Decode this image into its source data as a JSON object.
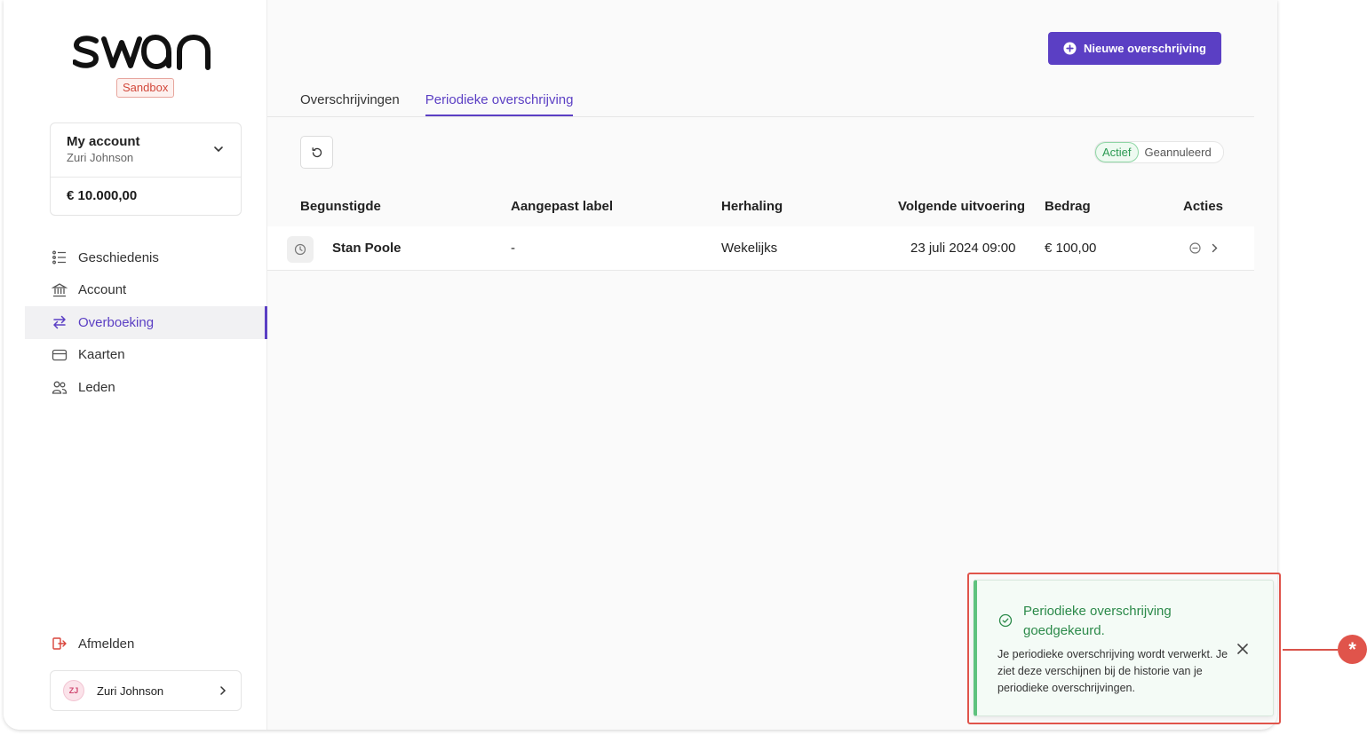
{
  "brand": {
    "logo_text": "swan",
    "env_badge": "Sandbox",
    "accent": "#5b3fc4"
  },
  "account": {
    "name": "My account",
    "holder": "Zuri Johnson",
    "balance": "€ 10.000,00"
  },
  "nav": {
    "items": [
      {
        "label": "Geschiedenis",
        "icon": "list-icon"
      },
      {
        "label": "Account",
        "icon": "bank-icon"
      },
      {
        "label": "Overboeking",
        "icon": "transfer-arrows-icon",
        "active": true
      },
      {
        "label": "Kaarten",
        "icon": "card-icon"
      },
      {
        "label": "Leden",
        "icon": "members-icon"
      }
    ],
    "logout": "Afmelden"
  },
  "user": {
    "initials": "ZJ",
    "name": "Zuri Johnson"
  },
  "header": {
    "new_button": "Nieuwe overschrijving"
  },
  "tabs": [
    {
      "label": "Overschrijvingen"
    },
    {
      "label": "Periodieke overschrijving",
      "active": true
    }
  ],
  "filters": {
    "active": "Actief",
    "cancelled": "Geannuleerd"
  },
  "table": {
    "columns": [
      "Begunstigde",
      "Aangepast label",
      "Herhaling",
      "Volgende uitvoering",
      "Bedrag",
      "Acties"
    ],
    "rows": [
      {
        "beneficiary": "Stan Poole",
        "label": "-",
        "recurrence": "Wekelijks",
        "next": "23 juli 2024 09:00",
        "amount": "€ 100,00"
      }
    ]
  },
  "toast": {
    "title": "Periodieke overschrijving goedgekeurd.",
    "body": "Je periodieke overschrijving wordt verwerkt. Je ziet deze verschijnen bij de historie van je periodieke overschrijvingen."
  },
  "callout": {
    "marker": "*"
  }
}
